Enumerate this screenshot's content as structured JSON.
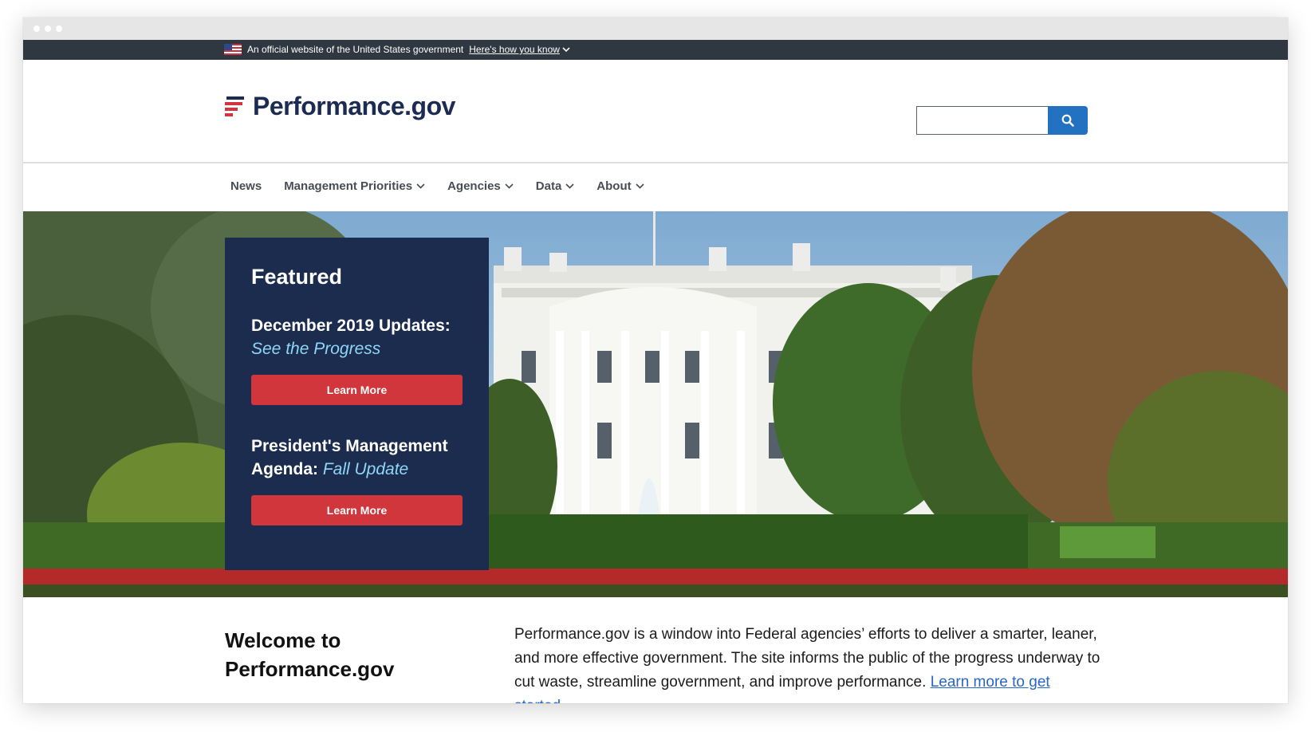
{
  "gov_banner": {
    "text": "An official website of the United States government",
    "link": "Here's how you know"
  },
  "header": {
    "site_name": "Performance.gov",
    "search_placeholder": "",
    "accent_color": "#2372c2",
    "brand_color": "#1b2b52"
  },
  "nav": {
    "items": [
      {
        "label": "News",
        "has_dropdown": false
      },
      {
        "label": "Management Priorities",
        "has_dropdown": true
      },
      {
        "label": "Agencies",
        "has_dropdown": true
      },
      {
        "label": "Data",
        "has_dropdown": true
      },
      {
        "label": "About",
        "has_dropdown": true
      }
    ]
  },
  "featured": {
    "title": "Featured",
    "item1": {
      "heading": "December 2019 Updates:",
      "accent": "See the Progress",
      "button": "Learn More"
    },
    "item2": {
      "heading": "President's Management Agenda:",
      "accent": "Fall Update",
      "button": "Learn More"
    },
    "panel_color": "#1c2c4f",
    "button_color": "#d0363c",
    "accent_color": "#8fd7f7"
  },
  "welcome": {
    "title": "Welcome to Performance.gov",
    "body": "Performance.gov is a window into Federal agencies’ efforts to deliver a smarter, leaner, and more effective government. The site informs the public of the progress underway to cut waste, streamline government, and improve performance.",
    "link": "Learn more to get started."
  }
}
